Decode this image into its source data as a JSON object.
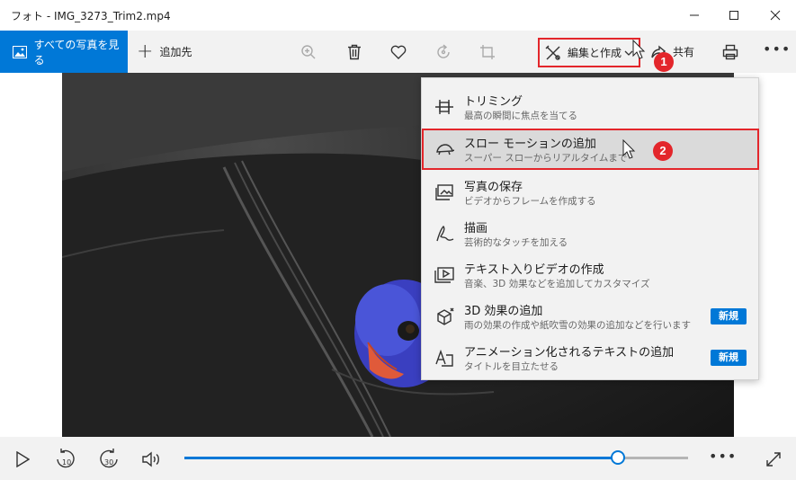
{
  "window": {
    "title": "フォト - IMG_3273_Trim2.mp4"
  },
  "toolbar": {
    "all_photos_label": "すべての写真を見る",
    "add_to_label": "追加先",
    "edit_create_label": "編集と作成",
    "share_label": "共有"
  },
  "menu": {
    "items": [
      {
        "title": "トリミング",
        "subtitle": "最高の瞬間に焦点を当てる",
        "icon": "trim-icon",
        "badge": ""
      },
      {
        "title": "スロー モーションの追加",
        "subtitle": "スーパー スローからリアルタイムまで",
        "icon": "turtle-icon",
        "badge": ""
      },
      {
        "title": "写真の保存",
        "subtitle": "ビデオからフレームを作成する",
        "icon": "save-photo-icon",
        "badge": ""
      },
      {
        "title": "描画",
        "subtitle": "芸術的なタッチを加える",
        "icon": "draw-pen-icon",
        "badge": ""
      },
      {
        "title": "テキスト入りビデオの作成",
        "subtitle": "音楽、3D 効果などを追加してカスタマイズ",
        "icon": "video-text-icon",
        "badge": ""
      },
      {
        "title": "3D 効果の追加",
        "subtitle": "雨の効果の作成や紙吹雪の効果の追加などを行います",
        "icon": "3d-effects-icon",
        "badge": "新規"
      },
      {
        "title": "アニメーション化されるテキストの追加",
        "subtitle": "タイトルを目立たせる",
        "icon": "animated-text-icon",
        "badge": "新規"
      }
    ]
  },
  "markers": {
    "step1": "1",
    "step2": "2"
  },
  "playback": {
    "rewind_seconds": "10",
    "forward_seconds": "30",
    "progress": 0.86
  },
  "colors": {
    "accent": "#0078d7",
    "highlight_border": "#e3262b",
    "toolbar_bg": "#f2f2f2"
  }
}
